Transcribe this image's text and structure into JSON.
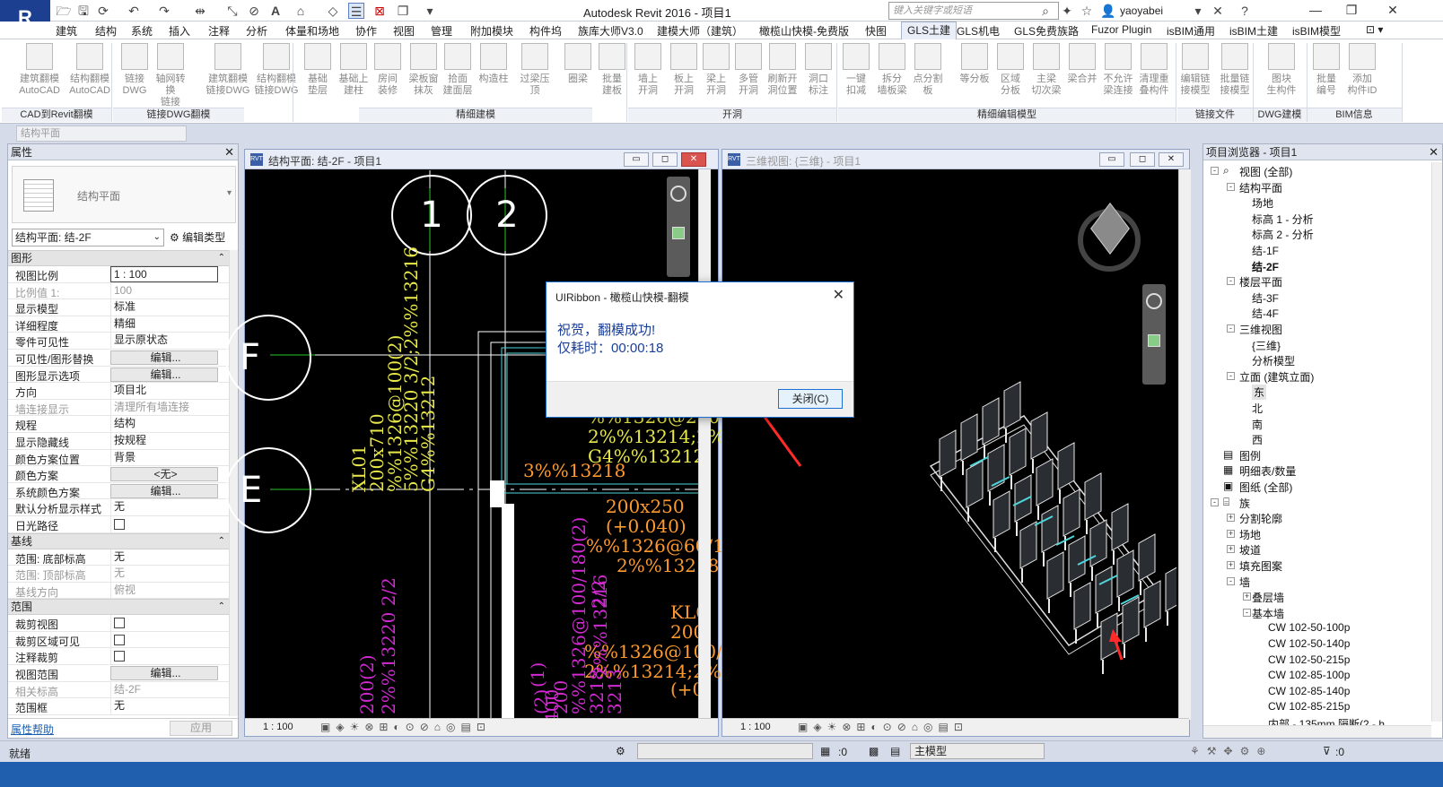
{
  "app": {
    "title": "Autodesk Revit 2016 -   项目1",
    "logo": "R",
    "search_placeholder": "键入关键字或短语",
    "user": "yaoyabei"
  },
  "ribbon_tabs": [
    "建筑",
    "结构",
    "系统",
    "插入",
    "注释",
    "分析",
    "体量和场地",
    "协作",
    "视图",
    "管理",
    "附加模块",
    "构件坞",
    "族库大师V3.0",
    "建模大师（建筑）",
    "橄榄山快模-免费版",
    "快图",
    "GLS土建",
    "GLS机电",
    "GLS免费族路",
    "Fuzor Plugin",
    "isBIM通用",
    "isBIM土建",
    "isBIM模型"
  ],
  "active_tab": "GLS土建",
  "ribbon_buttons": [
    {
      "l1": "建筑翻模",
      "l2": "AutoCAD"
    },
    {
      "l1": "结构翻模",
      "l2": "AutoCAD"
    },
    {
      "l1": "链接",
      "l2": "DWG"
    },
    {
      "l1": "轴网转换",
      "l2": "链接DWG"
    },
    {
      "l1": "建筑翻模",
      "l2": "链接DWG"
    },
    {
      "l1": "结构翻模",
      "l2": "链接DWG"
    },
    {
      "l1": "基础",
      "l2": "垫层"
    },
    {
      "l1": "基础上",
      "l2": "建柱"
    },
    {
      "l1": "房间",
      "l2": "装修"
    },
    {
      "l1": "梁板窗",
      "l2": "抹灰"
    },
    {
      "l1": "拾面",
      "l2": "建面层"
    },
    {
      "l1": "构造柱",
      "l2": ""
    },
    {
      "l1": "过梁压顶",
      "l2": ""
    },
    {
      "l1": "圈梁",
      "l2": ""
    },
    {
      "l1": "批量",
      "l2": "建板"
    },
    {
      "l1": "墙上",
      "l2": "开洞"
    },
    {
      "l1": "板上",
      "l2": "开洞"
    },
    {
      "l1": "梁上",
      "l2": "开洞"
    },
    {
      "l1": "多管",
      "l2": "开洞"
    },
    {
      "l1": "刷新开",
      "l2": "洞位置"
    },
    {
      "l1": "洞口",
      "l2": "标注"
    },
    {
      "l1": "一键",
      "l2": "扣减"
    },
    {
      "l1": "拆分",
      "l2": "墙板梁"
    },
    {
      "l1": "点分割板",
      "l2": ""
    },
    {
      "l1": "等分板",
      "l2": ""
    },
    {
      "l1": "区域",
      "l2": "分板"
    },
    {
      "l1": "主梁",
      "l2": "切次梁"
    },
    {
      "l1": "梁合并",
      "l2": ""
    },
    {
      "l1": "不允许",
      "l2": "梁连接"
    },
    {
      "l1": "清理重",
      "l2": "叠构件"
    },
    {
      "l1": "编辑链",
      "l2": "接模型"
    },
    {
      "l1": "批量链",
      "l2": "接模型"
    },
    {
      "l1": "图块",
      "l2": "生构件"
    },
    {
      "l1": "批量",
      "l2": "编号"
    },
    {
      "l1": "添加",
      "l2": "构件ID"
    }
  ],
  "ribbon_groups": [
    "CAD到Revit翻模",
    "链接DWG翻模",
    "精细建模",
    "开洞",
    "精细编辑模型",
    "链接文件",
    "DWG建模",
    "BIM信息"
  ],
  "options_bar": {
    "combo": "结构平面"
  },
  "properties": {
    "title": "属性",
    "type_name": "结构平面",
    "type_selector": "结构平面: 结-2F",
    "edit_type": "编辑类型",
    "sections": [
      {
        "name": "图形",
        "rows": [
          {
            "k": "视图比例",
            "v": "1 : 100",
            "kind": "input"
          },
          {
            "k": "比例值 1:",
            "v": "100",
            "kind": "dim"
          },
          {
            "k": "显示模型",
            "v": "标准"
          },
          {
            "k": "详细程度",
            "v": "精细"
          },
          {
            "k": "零件可见性",
            "v": "显示原状态"
          },
          {
            "k": "可见性/图形替换",
            "v": "编辑...",
            "kind": "btn"
          },
          {
            "k": "图形显示选项",
            "v": "编辑...",
            "kind": "btn"
          },
          {
            "k": "方向",
            "v": "项目北"
          },
          {
            "k": "墙连接显示",
            "v": "清理所有墙连接",
            "kind": "dim"
          },
          {
            "k": "规程",
            "v": "结构"
          },
          {
            "k": "显示隐藏线",
            "v": "按规程"
          },
          {
            "k": "颜色方案位置",
            "v": "背景"
          },
          {
            "k": "颜色方案",
            "v": "<无>",
            "kind": "btn"
          },
          {
            "k": "系统颜色方案",
            "v": "编辑...",
            "kind": "btn"
          },
          {
            "k": "默认分析显示样式",
            "v": "无"
          },
          {
            "k": "日光路径",
            "v": "",
            "kind": "check"
          }
        ]
      },
      {
        "name": "基线",
        "rows": [
          {
            "k": "范围: 底部标高",
            "v": "无"
          },
          {
            "k": "范围: 顶部标高",
            "v": "无",
            "kind": "dim"
          },
          {
            "k": "基线方向",
            "v": "俯视",
            "kind": "dim"
          }
        ]
      },
      {
        "name": "范围",
        "rows": [
          {
            "k": "裁剪视图",
            "v": "",
            "kind": "check"
          },
          {
            "k": "裁剪区域可见",
            "v": "",
            "kind": "check"
          },
          {
            "k": "注释裁剪",
            "v": "",
            "kind": "check"
          },
          {
            "k": "视图范围",
            "v": "编辑...",
            "kind": "btn"
          },
          {
            "k": "相关标高",
            "v": "结-2F",
            "kind": "dim"
          },
          {
            "k": "范围框",
            "v": "无"
          }
        ]
      }
    ],
    "help": "属性帮助",
    "apply": "应用"
  },
  "view_left": {
    "title": "结构平面: 结-2F - 项目1",
    "scale": "1 : 100",
    "grids": [
      "1",
      "2",
      "F",
      "E"
    ],
    "yellow_text": [
      "XL01",
      "200x710",
      "%%1326@100(2)",
      "5%%13220 3/2;2%%13216",
      "G4%%13212"
    ],
    "yellow_text_right": [
      "%%1326@200(2",
      "2%%13214;2%%",
      "G4%%13212"
    ],
    "orange_text": [
      "3%%13218",
      "200x250",
      "(+0.040)",
      "%%1326@60/120",
      "2%%13218",
      "KL0",
      "200",
      "%%1326@100/18",
      "2%%13214;2%%1",
      "(+0."
    ],
    "magenta_text": [
      "2%%13220 2/2",
      "200(2)",
      "2/2",
      "2%%13216",
      "(2)",
      "%%1326@100/180(2)",
      "200",
      "3218",
      "3213",
      "(1)",
      "400"
    ]
  },
  "view_right": {
    "title": "三维视图: {三维} - 项目1",
    "scale": "1 : 100"
  },
  "dialog": {
    "title": "UIRibbon - 橄榄山快模-翻模",
    "line1": "祝贺，翻模成功!",
    "line2": "仅耗时：00:00:18",
    "button": "关闭(C)"
  },
  "browser": {
    "title": "项目浏览器 - 项目1",
    "nodes": [
      {
        "t": "视图 (全部)",
        "lvl": 0,
        "box": "-"
      },
      {
        "t": "结构平面",
        "lvl": 1,
        "box": "-"
      },
      {
        "t": "场地",
        "lvl": 2
      },
      {
        "t": "标高 1 - 分析",
        "lvl": 2
      },
      {
        "t": "标高 2 - 分析",
        "lvl": 2
      },
      {
        "t": "结-1F",
        "lvl": 2
      },
      {
        "t": "结-2F",
        "lvl": 2,
        "bold": true
      },
      {
        "t": "楼层平面",
        "lvl": 1,
        "box": "-"
      },
      {
        "t": "结-3F",
        "lvl": 2
      },
      {
        "t": "结-4F",
        "lvl": 2
      },
      {
        "t": "三维视图",
        "lvl": 1,
        "box": "-"
      },
      {
        "t": "{三维}",
        "lvl": 2
      },
      {
        "t": "分析模型",
        "lvl": 2
      },
      {
        "t": "立面 (建筑立面)",
        "lvl": 1,
        "box": "-"
      },
      {
        "t": "东",
        "lvl": 2,
        "sel": true
      },
      {
        "t": "北",
        "lvl": 2
      },
      {
        "t": "南",
        "lvl": 2
      },
      {
        "t": "西",
        "lvl": 2
      },
      {
        "t": "图例",
        "lvl": 0
      },
      {
        "t": "明细表/数量",
        "lvl": 0
      },
      {
        "t": "图纸 (全部)",
        "lvl": 0
      },
      {
        "t": "族",
        "lvl": 0,
        "box": "-"
      },
      {
        "t": "分割轮廓",
        "lvl": 1,
        "box": "+"
      },
      {
        "t": "场地",
        "lvl": 1,
        "box": "+"
      },
      {
        "t": "坡道",
        "lvl": 1,
        "box": "+"
      },
      {
        "t": "填充图案",
        "lvl": 1,
        "box": "+"
      },
      {
        "t": "墙",
        "lvl": 1,
        "box": "-"
      },
      {
        "t": "叠层墙",
        "lvl": 2,
        "box": "+"
      },
      {
        "t": "基本墙",
        "lvl": 2,
        "box": "-"
      },
      {
        "t": "CW 102-50-100p",
        "lvl": 3
      },
      {
        "t": "CW 102-50-140p",
        "lvl": 3
      },
      {
        "t": "CW 102-50-215p",
        "lvl": 3
      },
      {
        "t": "CW 102-85-100p",
        "lvl": 3
      },
      {
        "t": "CW 102-85-140p",
        "lvl": 3
      },
      {
        "t": "CW 102-85-215p",
        "lvl": 3
      },
      {
        "t": "内部 - 135mm 隔断(2 - h",
        "lvl": 3
      }
    ]
  },
  "status": {
    "text": "就绪",
    "zero1": ":0",
    "model": "主模型",
    "zero2": ":0"
  },
  "colors": {
    "accent": "#1d6fd3",
    "cad_yellow": "#e8e84a",
    "cad_orange": "#ff9a2e",
    "cad_magenta": "#d22ad2",
    "cad_green": "#27c727",
    "cad_cyan": "#4fd5dc"
  }
}
